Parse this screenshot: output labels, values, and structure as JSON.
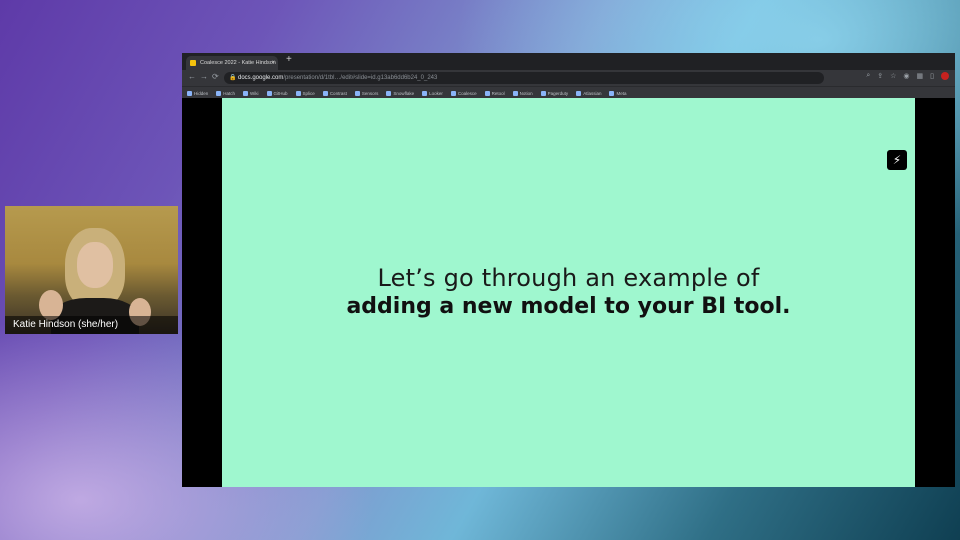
{
  "webcam": {
    "participant_name": "Katie Hindson (she/her)"
  },
  "browser": {
    "tab_title": "Coalesce 2022 - Katie Hindson",
    "url_host": "docs.google.com",
    "url_path": "/presentation/d/1tbl…/edit#slide=id.g13ab6dd6b24_0_243",
    "bookmarks": [
      "Hidden",
      "Hatch",
      "Wiki",
      "GitHub",
      "Splice",
      "Contrast",
      "Sensors",
      "Snowflake",
      "Looker",
      "Coalesce",
      "Retool",
      "Notion",
      "Pagerduty",
      "Atlassian",
      "Meta"
    ]
  },
  "slide": {
    "line1": "Let’s go through an example of",
    "line2": "adding a new model to your BI tool."
  },
  "icons": {
    "bolt": "⚡",
    "lock": "🔒",
    "back": "←",
    "forward": "→",
    "reload": "⟳",
    "new_tab": "+",
    "close": "×"
  },
  "colors": {
    "slide_bg": "#9ff7cf",
    "browser_chrome": "#202124"
  }
}
